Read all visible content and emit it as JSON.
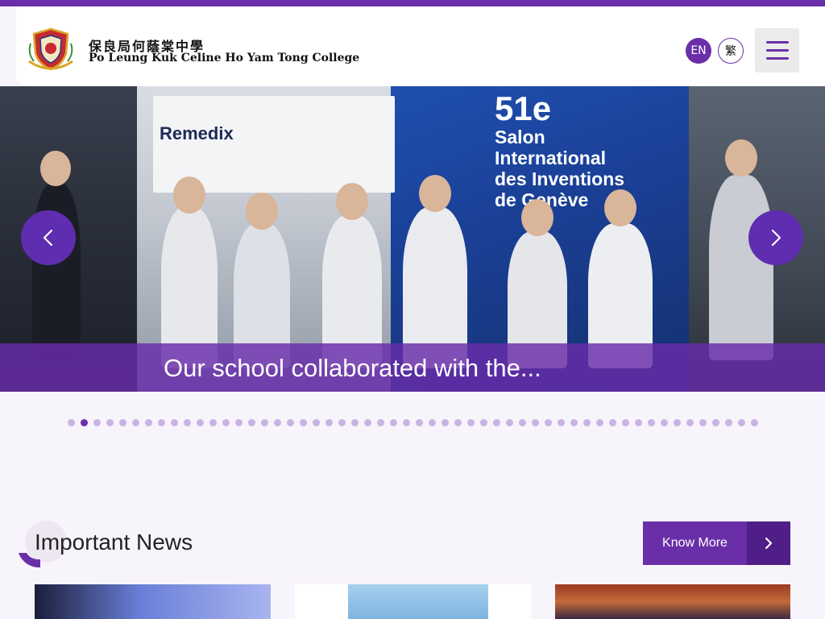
{
  "header": {
    "school_name_zh": "保良局何蔭棠中學",
    "school_name_en": "Po Leung Kuk Celine Ho Yam Tong College",
    "lang_en_label": "EN",
    "lang_zh_label": "繁",
    "menu_icon": "hamburger-menu-icon"
  },
  "carousel": {
    "caption": "Our school collaborated with the...",
    "slide_text": {
      "poster_title": "Remedix",
      "salon_number": "51e",
      "salon_line1": "Salon",
      "salon_line2": "International",
      "salon_line3": "des Inventions",
      "salon_line4": "de Genève"
    },
    "prev_icon": "chevron-left-icon",
    "next_icon": "chevron-right-icon",
    "dot_count": 54,
    "active_dot": 1
  },
  "news": {
    "title": "Important News",
    "know_more_label": "Know More",
    "know_more_icon": "chevron-right-icon"
  },
  "colors": {
    "brand_purple": "#6a2fa8",
    "brand_purple_dark": "#4f1f87",
    "page_background": "#f8f4fb",
    "dot_inactive": "#c9b3e4"
  }
}
